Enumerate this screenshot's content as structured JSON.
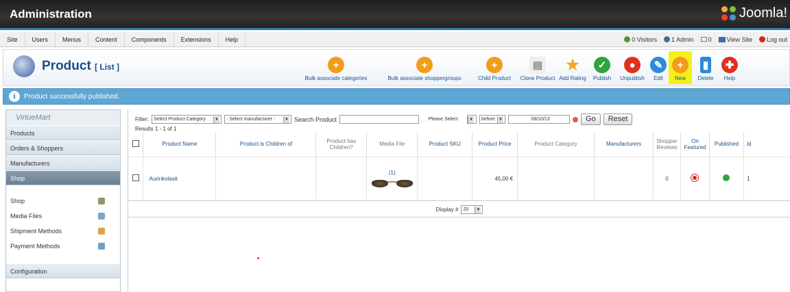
{
  "header": {
    "title": "Administration",
    "logo": "Joomla!"
  },
  "menu": {
    "items": [
      "Site",
      "Users",
      "Menus",
      "Content",
      "Components",
      "Extensions",
      "Help"
    ],
    "status": {
      "visitors": "0 Visitors",
      "admin": "1 Admin",
      "messages": "0",
      "view_site": "View Site",
      "logout": "Log out"
    }
  },
  "toolbar": {
    "page_title": "Product",
    "page_subtitle": "[ List ]",
    "buttons": [
      {
        "label": "Bulk associate categories",
        "icon": "plus-icon",
        "color": "#f39c1b"
      },
      {
        "label": "Bulk associate shoppergroups",
        "icon": "plus-icon",
        "color": "#f39c1b"
      },
      {
        "label": "Child Product",
        "icon": "plus-icon",
        "color": "#f39c1b"
      },
      {
        "label": "Clone Product",
        "icon": "copy-icon",
        "color": "#cccccc"
      },
      {
        "label": "Add Rating",
        "icon": "star-icon",
        "color": "#f5a623"
      },
      {
        "label": "Publish",
        "icon": "check-icon",
        "color": "#2ea43b"
      },
      {
        "label": "Unpublish",
        "icon": "circle-icon",
        "color": "#e0301e"
      },
      {
        "label": "Edit",
        "icon": "pencil-icon",
        "color": "#2c8ad7"
      },
      {
        "label": "New",
        "icon": "plus-icon",
        "color": "#f39c1b"
      },
      {
        "label": "Delete",
        "icon": "trash-icon",
        "color": "#2c8ad7"
      },
      {
        "label": "Help",
        "icon": "help-icon",
        "color": "#e0301e"
      }
    ]
  },
  "message": {
    "text": "Product successfully published."
  },
  "sidebar": {
    "brand": "VirtueMart",
    "sections": [
      "Products",
      "Orders & Shoppers",
      "Manufacturers",
      "Shop"
    ],
    "shop_items": [
      "Shop",
      "Media Files",
      "Shipment Methods",
      "Payment Methods"
    ],
    "bottom": "Configuration"
  },
  "filter": {
    "label": "Filter:",
    "category": "Select Product Category",
    "manufacturer": "- Select manufacturer -",
    "search_label": "Search Product",
    "please_select": "Please Select",
    "before": "before",
    "date": "08/10/13",
    "go": "Go",
    "reset": "Reset",
    "results": "Results 1 - 1 of 1"
  },
  "table": {
    "headers": [
      "Product Name",
      "Product is Children of",
      "Product has Children?",
      "Media File",
      "Product SKU",
      "Product Price",
      "Product Category",
      "Manufacturers",
      "Shopper Reviews",
      "On Featured",
      "Published",
      "Id"
    ],
    "rows": [
      {
        "name": "Aurinkolasit",
        "children_of": "",
        "has_children": "",
        "media": "(1)",
        "sku": "",
        "price": "45,00 €",
        "category": "",
        "manufacturers": "",
        "reviews": "0",
        "id": "1"
      }
    ]
  },
  "display": {
    "label": "Display #",
    "value": "20"
  }
}
